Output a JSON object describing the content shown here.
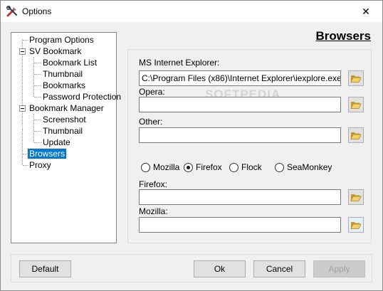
{
  "window": {
    "title": "Options",
    "close_symbol": "✕"
  },
  "tree": {
    "items": [
      {
        "label": "Program Options"
      },
      {
        "label": "SV Bookmark"
      },
      {
        "label": "Bookmark List"
      },
      {
        "label": "Thumbnail"
      },
      {
        "label": "Bookmarks"
      },
      {
        "label": "Password Protection"
      },
      {
        "label": "Bookmark Manager"
      },
      {
        "label": "Screenshot"
      },
      {
        "label": "Thumbnail"
      },
      {
        "label": "Update"
      },
      {
        "label": "Browsers",
        "selected": true
      },
      {
        "label": "Proxy"
      }
    ]
  },
  "page": {
    "heading": "Browsers"
  },
  "fields": {
    "ie": {
      "label": "MS Internet Explorer:",
      "value": "C:\\Program Files (x86)\\Internet Explorer\\iexplore.exe"
    },
    "opera": {
      "label": "Opera:",
      "value": ""
    },
    "other": {
      "label": "Other:",
      "value": ""
    },
    "firefox": {
      "label": "Firefox:",
      "value": ""
    },
    "mozilla": {
      "label": "Mozilla:",
      "value": ""
    }
  },
  "radios": [
    {
      "label": "Mozilla",
      "checked": false
    },
    {
      "label": "Firefox",
      "checked": true
    },
    {
      "label": "Flock",
      "checked": false
    },
    {
      "label": "SeaMonkey",
      "checked": false
    }
  ],
  "buttons": {
    "default": "Default",
    "ok": "Ok",
    "cancel": "Cancel",
    "apply": "Apply"
  },
  "watermark": "SOFTPEDIA",
  "icons": {
    "browse": "folder-open-icon",
    "app": "tools-icon",
    "close": "close-icon"
  },
  "colors": {
    "selection": "#0078d7",
    "folder": "#e8c25a"
  }
}
